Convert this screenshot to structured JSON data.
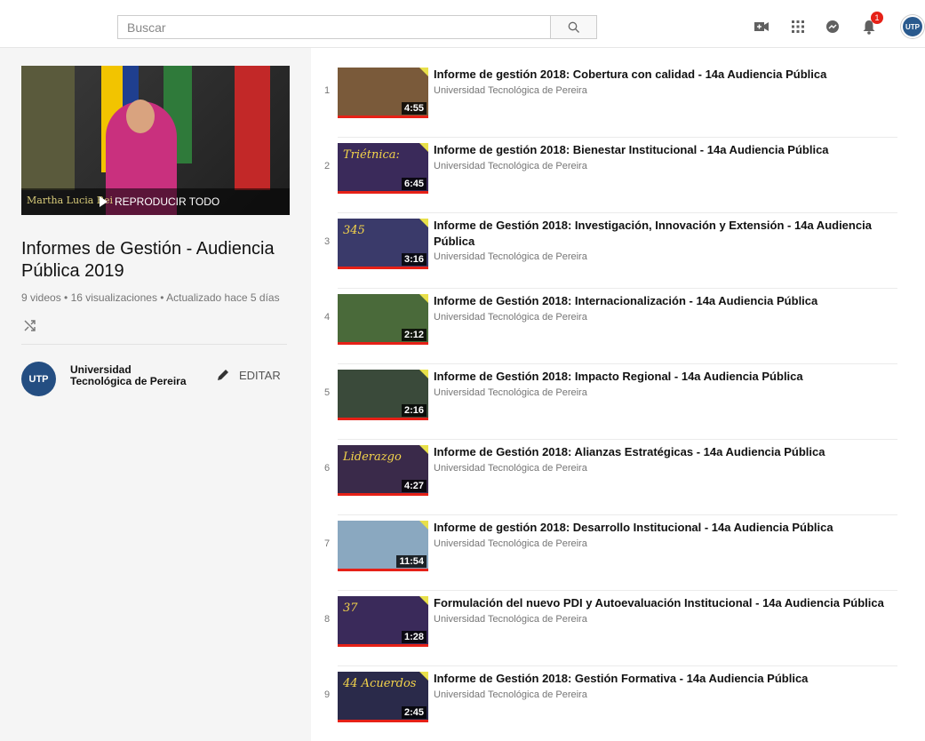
{
  "header": {
    "search_placeholder": "Buscar",
    "notifications_count": "1",
    "avatar_text": "UTP"
  },
  "playlist": {
    "hero_name": "Martha Lucia Rei",
    "play_all_label": "REPRODUCIR TODO",
    "title": "Informes de Gestión - Audiencia Pública 2019",
    "meta": "9 videos • 16 visualizaciones • Actualizado hace 5 días",
    "owner_avatar": "UTP",
    "owner_name": "Universidad Tecnológica de Pereira",
    "edit_label": "EDITAR"
  },
  "videos": [
    {
      "index": "1",
      "title": "Informe de gestión 2018: Cobertura con calidad - 14a Audiencia Pública",
      "channel": "Universidad Tecnológica de Pereira",
      "duration": "4:55",
      "thumb_text": "",
      "thumb_bg": "#7a5a3a"
    },
    {
      "index": "2",
      "title": "Informe de gestión 2018: Bienestar Institucional - 14a Audiencia Pública",
      "channel": "Universidad Tecnológica de Pereira",
      "duration": "6:45",
      "thumb_text": "Triétnica:",
      "thumb_bg": "#3a2a5a"
    },
    {
      "index": "3",
      "title": "Informe de Gestión 2018: Investigación, Innovación y Extensión - 14a Audiencia Pública",
      "channel": "Universidad Tecnológica de Pereira",
      "duration": "3:16",
      "thumb_text": "345",
      "thumb_bg": "#3a3a6a"
    },
    {
      "index": "4",
      "title": "Informe de Gestión 2018: Internacionalización - 14a Audiencia Pública",
      "channel": "Universidad Tecnológica de Pereira",
      "duration": "2:12",
      "thumb_text": "",
      "thumb_bg": "#4a6a3a"
    },
    {
      "index": "5",
      "title": "Informe de Gestión 2018: Impacto Regional - 14a Audiencia Pública",
      "channel": "Universidad Tecnológica de Pereira",
      "duration": "2:16",
      "thumb_text": "",
      "thumb_bg": "#3a4a3a"
    },
    {
      "index": "6",
      "title": "Informe de Gestión 2018: Alianzas Estratégicas - 14a Audiencia Pública",
      "channel": "Universidad Tecnológica de Pereira",
      "duration": "4:27",
      "thumb_text": "Liderazgo",
      "thumb_bg": "#3a2a4a"
    },
    {
      "index": "7",
      "title": "Informe de gestión 2018: Desarrollo Institucional - 14a Audiencia Pública",
      "channel": "Universidad Tecnológica de Pereira",
      "duration": "11:54",
      "thumb_text": "",
      "thumb_bg": "#8aa8c0"
    },
    {
      "index": "8",
      "title": "Formulación del nuevo PDI y Autoevaluación Institucional - 14a Audiencia Pública",
      "channel": "Universidad Tecnológica de Pereira",
      "duration": "1:28",
      "thumb_text": "37",
      "thumb_bg": "#3a2a5a"
    },
    {
      "index": "9",
      "title": "Informe de Gestión 2018: Gestión Formativa - 14a Audiencia Pública",
      "channel": "Universidad Tecnológica de Pereira",
      "duration": "2:45",
      "thumb_text": "44 Acuerdos",
      "thumb_bg": "#2a2a4a"
    }
  ],
  "colors": {
    "accent_red": "#e62117",
    "brand_blue": "#244e82",
    "caption_yellow": "#e8e04a"
  },
  "icons": [
    "search-icon",
    "video-camera-icon",
    "apps-grid-icon",
    "messages-icon",
    "bell-icon",
    "shuffle-icon",
    "pencil-icon",
    "play-icon"
  ]
}
